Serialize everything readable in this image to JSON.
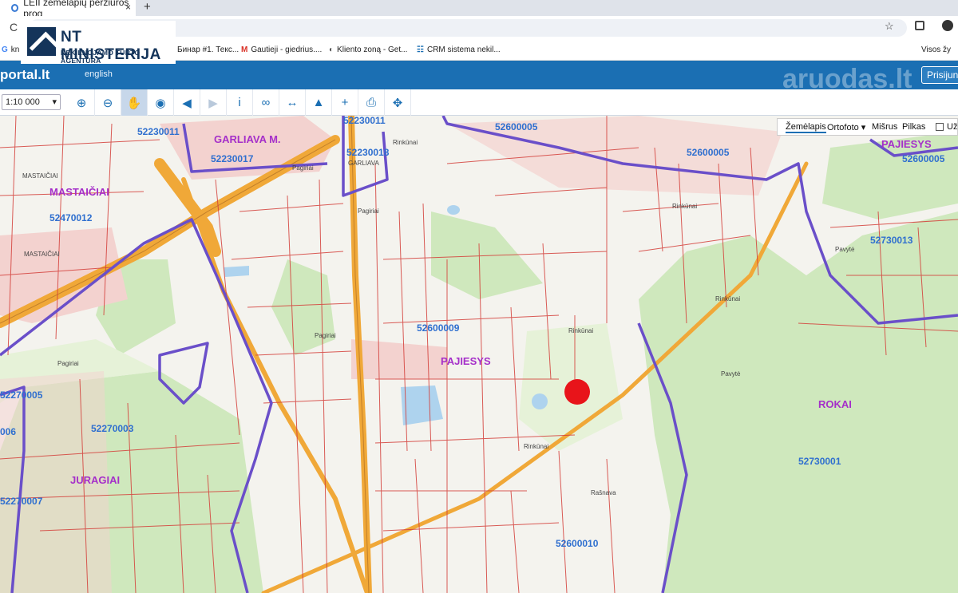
{
  "browser": {
    "tab_title": "LEII žemėlapių peržiūros prog",
    "close_glyph": "×",
    "new_tab_glyph": "+",
    "reload_glyph": "C",
    "bookmarks": [
      {
        "icon": "G",
        "label": "kn"
      },
      {
        "icon": "",
        "label": "Бинар #1. Текс..."
      },
      {
        "icon": "M",
        "label": "Gautieji - giedrius...."
      },
      {
        "icon": "◐",
        "label": "Kliento zoną - Get..."
      },
      {
        "icon": "☷",
        "label": "CRM sistema nekil..."
      },
      {
        "icon": "",
        "label": "Visos žy"
      }
    ]
  },
  "logo": {
    "line1": "NT MINISTERIJA",
    "line2": "NEKILNOJAMO TURTO AGENTŪRA"
  },
  "portal": {
    "title": "portal.lt",
    "language": "english",
    "watermark": "aruodas.lt",
    "login": "Prisijung"
  },
  "toolbar": {
    "scale": "1:10 000",
    "tools": [
      {
        "name": "zoom-in-tool",
        "glyph": "⊕"
      },
      {
        "name": "zoom-out-tool",
        "glyph": "⊖"
      },
      {
        "name": "pan-tool",
        "glyph": "✋"
      },
      {
        "name": "globe-tool",
        "glyph": "◉"
      },
      {
        "name": "back-tool",
        "glyph": "◀"
      },
      {
        "name": "forward-tool",
        "glyph": "▶"
      },
      {
        "name": "info-tool",
        "glyph": "i"
      },
      {
        "name": "link-tool",
        "glyph": "∞"
      },
      {
        "name": "measure-tool",
        "glyph": "↔"
      },
      {
        "name": "profile-tool",
        "glyph": "▲"
      },
      {
        "name": "add-tool",
        "glyph": "+"
      },
      {
        "name": "print-tool",
        "glyph": "⎙"
      },
      {
        "name": "locate-tool",
        "glyph": "✥"
      }
    ]
  },
  "layers": {
    "items": [
      "Žemėlapis",
      "Ortofoto ▾",
      "Mišrus",
      "Pilkas"
    ],
    "selected": "Žemėlapis",
    "checkbox_label": "Užra"
  },
  "map": {
    "area_labels": [
      "GARLIAVA M.",
      "MASTAIČIAI",
      "PAJIESYS",
      "PAJIESYS",
      "ROKAI",
      "JURAGIAI"
    ],
    "code_labels": [
      "52230011",
      "52230017",
      "52230011",
      "52230018",
      "52600005",
      "52600005",
      "52600005",
      "52470012",
      "52730013",
      "52600009",
      "52730001",
      "52270003",
      "52270007",
      "52270005",
      "52600010",
      "006"
    ],
    "place_labels": [
      "MASTAIČIAI",
      "MASTAIČIAI",
      "GARLIAVA",
      "Pagiriai",
      "Pagiriai",
      "Pagiriai",
      "Rinkūnai",
      "Rinkūnai",
      "Rinkūnai",
      "Rinkūnai",
      "Rinkūnai",
      "Pavytė",
      "Pavytė",
      "Rašnava",
      "Pagiriai"
    ],
    "colors": {
      "boundary": "#6a4fc9",
      "parcel": "#d43f3a",
      "road": "#f0a838",
      "forest": "#c8e6b4",
      "code": "#2f6fcf",
      "area": "#a52fc9",
      "marker": "#e8141a"
    }
  }
}
